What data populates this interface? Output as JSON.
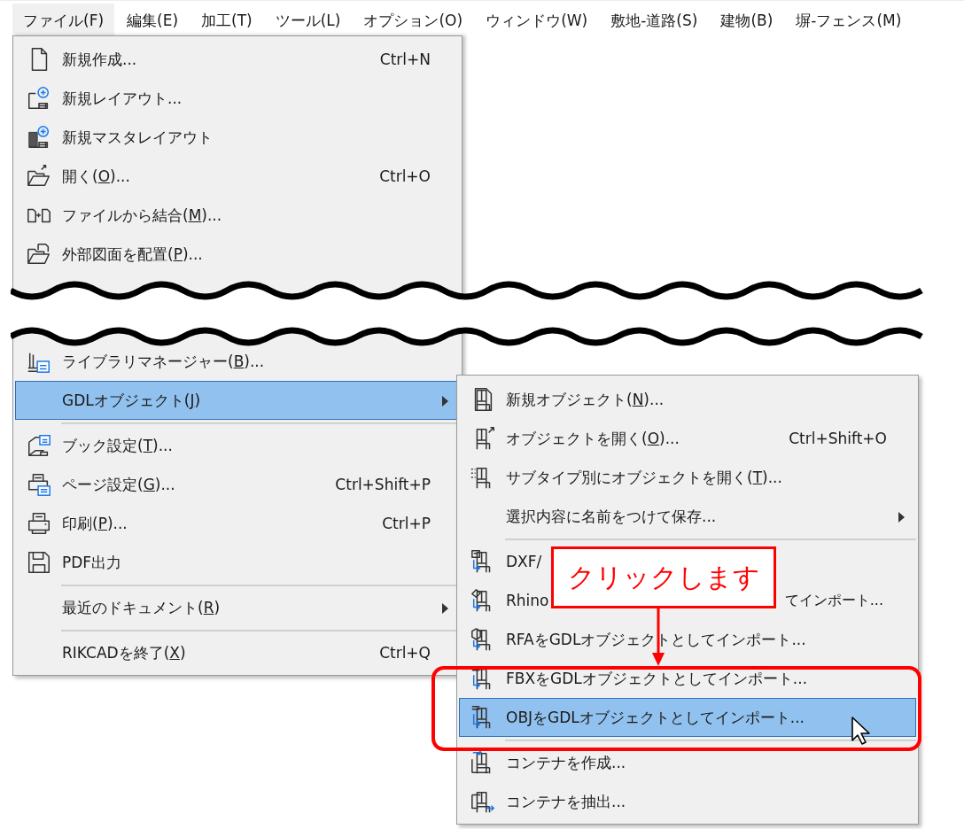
{
  "menu_bar": [
    {
      "label": "ファイル(F)",
      "selected": true
    },
    {
      "label": "編集(E)",
      "selected": false
    },
    {
      "label": "加工(T)",
      "selected": false
    },
    {
      "label": "ツール(L)",
      "selected": false
    },
    {
      "label": "オプション(O)",
      "selected": false
    },
    {
      "label": "ウィンドウ(W)",
      "selected": false
    },
    {
      "label": "敷地-道路(S)",
      "selected": false
    },
    {
      "label": "建物(B)",
      "selected": false
    },
    {
      "label": "塀-フェンス(M)",
      "selected": false
    }
  ],
  "file_menu": {
    "items_before_break": [
      {
        "kind": "item",
        "label": "新規作成...",
        "shortcut": "Ctrl+N",
        "selected": false
      },
      {
        "kind": "item",
        "label": "新規レイアウト...",
        "selected": false
      },
      {
        "kind": "item",
        "label": "新規マスタレイアウト",
        "selected": false
      },
      {
        "kind": "item",
        "label": "開く(",
        "mnemonic": "O",
        "label_after": ")...",
        "shortcut": "Ctrl+O",
        "selected": false
      },
      {
        "kind": "item",
        "label": "ファイルから結合(",
        "mnemonic": "M",
        "label_after": ")...",
        "selected": false
      },
      {
        "kind": "item",
        "label": "外部図面を配置(",
        "mnemonic": "P",
        "label_after": ")...",
        "selected": false
      }
    ],
    "items_after_break": [
      {
        "kind": "item",
        "label": "ライブラリマネージャー(",
        "mnemonic": "B",
        "label_after": ")...",
        "selected": false
      },
      {
        "kind": "item",
        "label": "GDLオブジェクト(",
        "mnemonic": "J",
        "label_after": ")",
        "submenu": true,
        "selected": true
      },
      {
        "kind": "separator"
      },
      {
        "kind": "item",
        "label": "ブック設定(",
        "mnemonic": "T",
        "label_after": ")...",
        "selected": false
      },
      {
        "kind": "item",
        "label": "ページ設定(",
        "mnemonic": "G",
        "label_after": ")...",
        "shortcut": "Ctrl+Shift+P",
        "selected": false
      },
      {
        "kind": "item",
        "label": "印刷(",
        "mnemonic": "P",
        "label_after": ")...",
        "shortcut": "Ctrl+P",
        "selected": false
      },
      {
        "kind": "item",
        "label": "PDF出力",
        "selected": false
      },
      {
        "kind": "separator"
      },
      {
        "kind": "item",
        "label": "最近のドキュメント(",
        "mnemonic": "R",
        "label_after": ")",
        "submenu": true,
        "selected": false
      },
      {
        "kind": "separator"
      },
      {
        "kind": "item",
        "label": "RIKCADを終了(",
        "mnemonic": "X",
        "label_after": ")",
        "shortcut": "Ctrl+Q",
        "selected": false
      }
    ]
  },
  "gdl_submenu": [
    {
      "kind": "item",
      "label": "新規オブジェクト(",
      "mnemonic": "N",
      "label_after": ")...",
      "selected": false
    },
    {
      "kind": "item",
      "label": "オブジェクトを開く(",
      "mnemonic": "O",
      "label_after": ")...",
      "shortcut": "Ctrl+Shift+O",
      "selected": false
    },
    {
      "kind": "item",
      "label": "サブタイプ別にオブジェクトを開く(",
      "mnemonic": "T",
      "label_after": ")...",
      "selected": false
    },
    {
      "kind": "item",
      "label": "選択内容に名前をつけて保存...",
      "submenu": true,
      "selected": false
    },
    {
      "kind": "separator"
    },
    {
      "kind": "item",
      "label": "DXF/",
      "selected": false
    },
    {
      "kind": "item",
      "label": "Rhino",
      "label_tail": "てインポート...",
      "selected": false
    },
    {
      "kind": "item",
      "label": "RFAをGDLオブジェクトとしてインポート...",
      "selected": false
    },
    {
      "kind": "item",
      "label": "FBXをGDLオブジェクトとしてインポート...",
      "selected": false
    },
    {
      "kind": "item",
      "label": "OBJをGDLオブジェクトとしてインポート...",
      "selected": true
    },
    {
      "kind": "separator"
    },
    {
      "kind": "item",
      "label": "コンテナを作成...",
      "selected": false
    },
    {
      "kind": "item",
      "label": "コンテナを抽出...",
      "selected": false
    }
  ],
  "callout": {
    "text": "クリックします"
  }
}
